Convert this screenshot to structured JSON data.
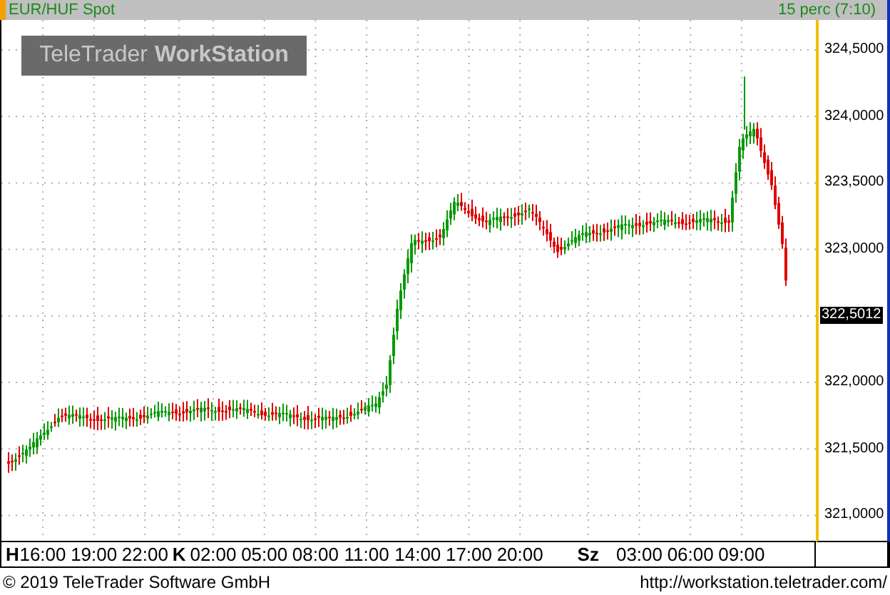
{
  "header": {
    "instrument": "EUR/HUF Spot",
    "interval": "15 perc (7:10)"
  },
  "logo": {
    "brand": "TeleTrader",
    "product": "WorkStation"
  },
  "price_axis": {
    "ticks": [
      "324,5000",
      "324,0000",
      "323,5000",
      "323,0000",
      "322,0000",
      "321,5000",
      "321,0000"
    ],
    "last_price": "322,5012"
  },
  "time_axis": {
    "labels": [
      {
        "text": "H",
        "kind": "day"
      },
      {
        "text": "16:00",
        "kind": "time"
      },
      {
        "text": "19:00",
        "kind": "time"
      },
      {
        "text": "22:00",
        "kind": "time"
      },
      {
        "text": "K",
        "kind": "day"
      },
      {
        "text": "02:00",
        "kind": "time"
      },
      {
        "text": "05:00",
        "kind": "time"
      },
      {
        "text": "08:00",
        "kind": "time"
      },
      {
        "text": "11:00",
        "kind": "time"
      },
      {
        "text": "14:00",
        "kind": "time"
      },
      {
        "text": "17:00",
        "kind": "time"
      },
      {
        "text": "20:00",
        "kind": "time"
      },
      {
        "text": "Sz",
        "kind": "day"
      },
      {
        "text": "03:00",
        "kind": "time"
      },
      {
        "text": "06:00",
        "kind": "time"
      },
      {
        "text": "09:00",
        "kind": "time"
      }
    ]
  },
  "footer": {
    "copyright": "© 2019 TeleTrader Software GmbH",
    "url": "http://workstation.teletrader.com/"
  }
}
